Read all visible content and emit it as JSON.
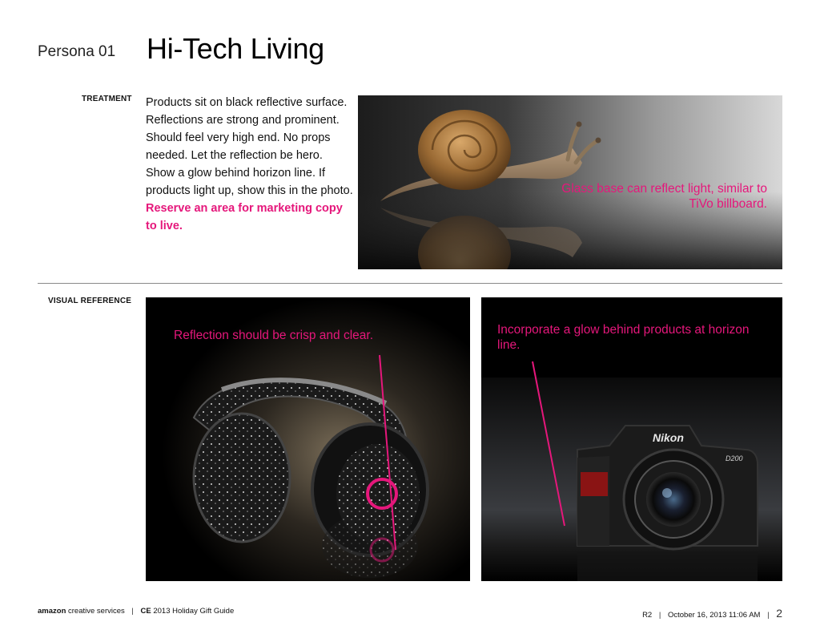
{
  "header": {
    "persona": "Persona 01",
    "title": "Hi-Tech Living"
  },
  "treatment": {
    "label": "TREATMENT",
    "body": "Products sit on black reflective surface. Reflections are strong and prominent. Should feel very high end. No props needed. Let the reflection be hero. Show a glow behind horizon line. If products light up, show this in the photo.",
    "highlight": "Reserve an area for marketing copy to live."
  },
  "visual_reference": {
    "label": "VISUAL REFERENCE"
  },
  "annotations": {
    "glass": "Glass base can reflect light, similar to TiVo billboard.",
    "reflection": "Reflection should be crisp and clear.",
    "glow": "Incorporate a glow behind products at horizon line."
  },
  "photo_text": {
    "camera_brand": "Nikon",
    "camera_model": "D200"
  },
  "footer": {
    "brand": "amazon",
    "brand_suffix": "creative services",
    "project_prefix": "CE",
    "project": "2013 Holiday Gift Guide",
    "revision": "R2",
    "date": "October 16, 2013 11:06 AM",
    "page": "2"
  },
  "colors": {
    "accent": "#e5177b"
  }
}
